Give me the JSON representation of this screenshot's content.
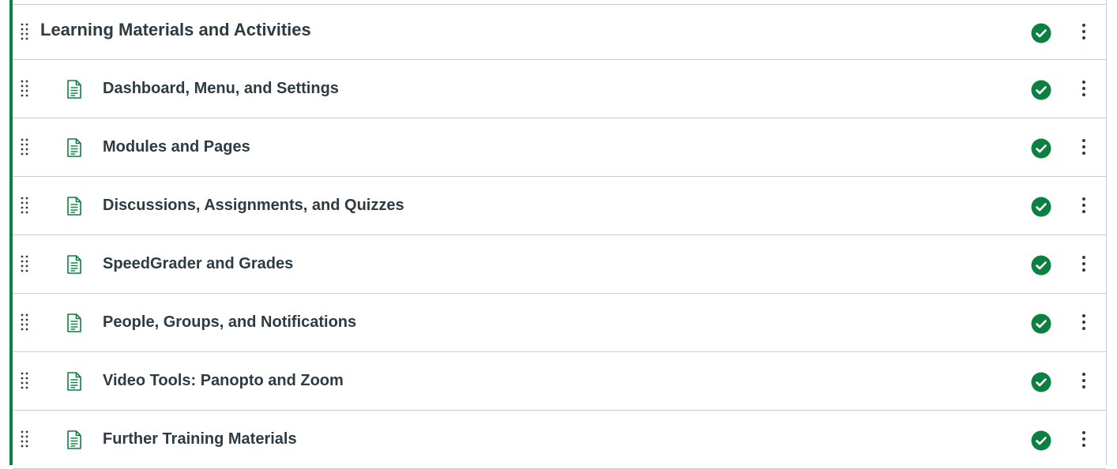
{
  "module": {
    "title": "Learning Materials and Activities",
    "status_icon": "published-check-icon",
    "accent_color": "#0b8040"
  },
  "items": [
    {
      "title": "Dashboard, Menu, and Settings",
      "icon": "page-icon",
      "status": "published"
    },
    {
      "title": "Modules and Pages",
      "icon": "page-icon",
      "status": "published"
    },
    {
      "title": "Discussions, Assignments, and Quizzes",
      "icon": "page-icon",
      "status": "published"
    },
    {
      "title": "SpeedGrader and Grades",
      "icon": "page-icon",
      "status": "published"
    },
    {
      "title": "People, Groups, and Notifications",
      "icon": "page-icon",
      "status": "published"
    },
    {
      "title": "Video Tools: Panopto and Zoom",
      "icon": "page-icon",
      "status": "published"
    },
    {
      "title": "Further Training Materials",
      "icon": "page-icon",
      "status": "published"
    }
  ],
  "colors": {
    "published_green": "#0b8040",
    "text": "#2d3b45",
    "border": "#c7cdd1"
  }
}
